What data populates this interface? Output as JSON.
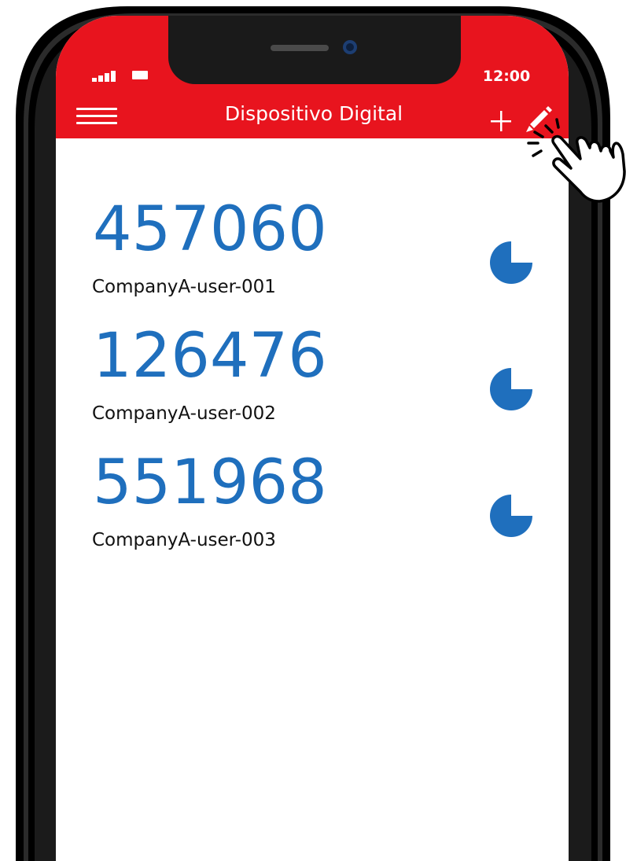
{
  "status_bar": {
    "time": "12:00",
    "signal_icon": "signal-bars-icon",
    "battery_icon": "battery-icon"
  },
  "app_bar": {
    "title": "Dispositivo Digital",
    "menu_icon": "hamburger-menu-icon",
    "add_icon": "plus-icon",
    "edit_icon": "pencil-icon",
    "background_color": "#e8141e"
  },
  "tokens": [
    {
      "code": "457060",
      "account": "CompanyA-user-001",
      "timer_remaining_fraction": 0.75
    },
    {
      "code": "126476",
      "account": "CompanyA-user-002",
      "timer_remaining_fraction": 0.75
    },
    {
      "code": "551968",
      "account": "CompanyA-user-003",
      "timer_remaining_fraction": 0.75
    }
  ],
  "colors": {
    "accent": "#e8141e",
    "code_blue": "#1f6fbd",
    "frame_dark": "#1b1b1b"
  },
  "overlay": {
    "tap_indicator_icon": "pointing-hand-icon"
  }
}
